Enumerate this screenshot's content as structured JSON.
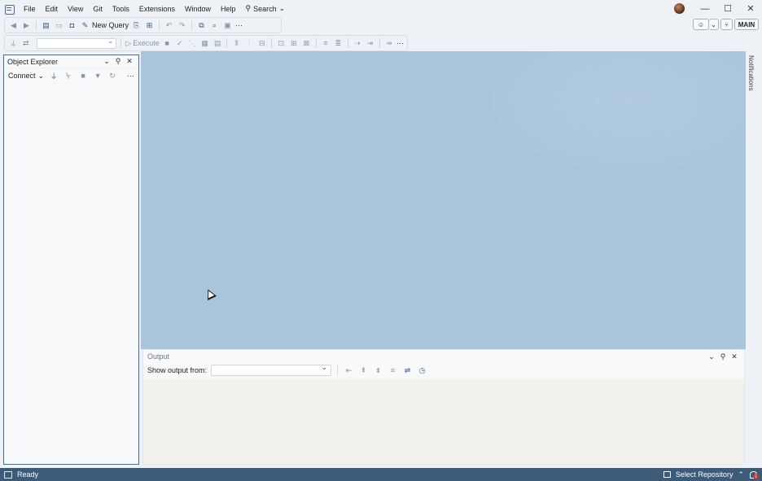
{
  "menu": {
    "items": [
      "File",
      "Edit",
      "View",
      "Git",
      "Tools",
      "Extensions",
      "Window",
      "Help"
    ],
    "search_label": "Search"
  },
  "toolbar": {
    "new_query_label": "New Query",
    "execute_label": "Execute",
    "more_label": "···"
  },
  "right_toolbar": {
    "branch_label": "MAIN"
  },
  "notifications": {
    "label": "Notifications"
  },
  "object_explorer": {
    "title": "Object Explorer",
    "connect_label": "Connect",
    "more_label": "···"
  },
  "output": {
    "title": "Output",
    "show_output_label": "Show output from:",
    "selected_source": ""
  },
  "status": {
    "ready_label": "Ready",
    "repository_label": "Select Repository",
    "notification_count": "1"
  },
  "colors": {
    "accent": "#3e6e99",
    "workspace": "#a9c5dc",
    "statusbar": "#3c5b79",
    "badge": "#d13438"
  },
  "icons": [
    "app-icon",
    "search-icon",
    "minimize-icon",
    "maximize-icon",
    "close-icon",
    "copilot-icon",
    "git-branch-icon",
    "pin-icon",
    "plug-icon",
    "filter-icon",
    "refresh-icon",
    "stop-icon",
    "bell-icon"
  ]
}
